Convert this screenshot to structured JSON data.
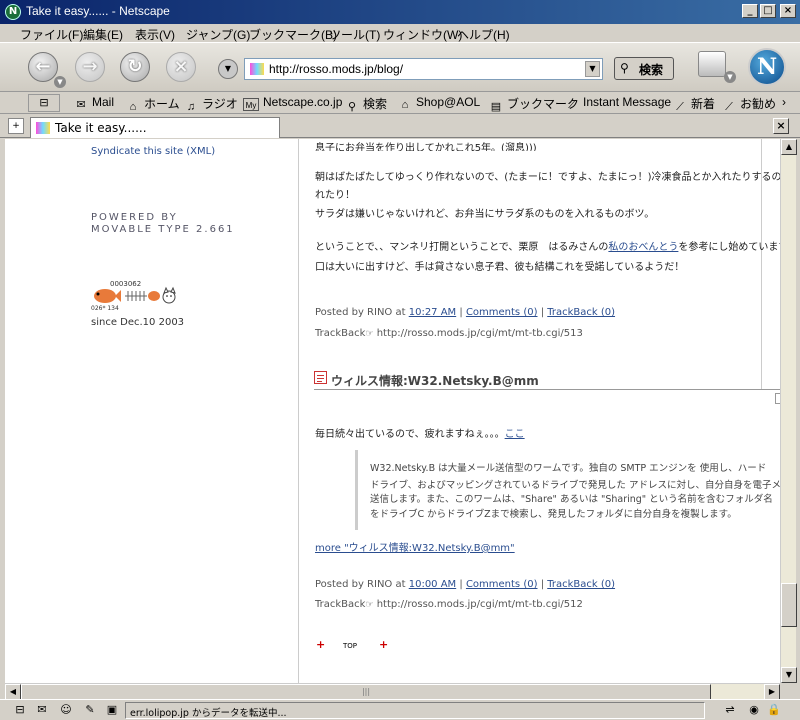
{
  "window": {
    "title": "Take it easy...... - Netscape"
  },
  "menu": [
    "ファイル(F)",
    "編集(E)",
    "表示(V)",
    "ジャンプ(G)",
    "ブックマーク(B)",
    "ツール(T)",
    "ウィンドウ(W)",
    "ヘルプ(H)"
  ],
  "nav": {
    "url": "http://rosso.mods.jp/blog/",
    "search_label": "検索"
  },
  "personal_bar": [
    "Mail",
    "ホーム",
    "ラジオ",
    "Netscape.co.jp",
    "検索",
    "Shop@AOL",
    "ブックマーク",
    "Instant Message",
    "新着",
    "お勧め"
  ],
  "tab": {
    "label": "Take it easy......"
  },
  "sidebar": {
    "syndicate": "Syndicate this site (XML)",
    "powered_line1": "POWERED BY",
    "powered_line2": "MOVABLE TYPE 2.661",
    "counter": "0003062",
    "counter_small": "026* 134",
    "since": "since Dec.10 2003"
  },
  "post1": {
    "cut_line": "息子にお弁当を作り出してかれこれ5年。(溜息)))",
    "para1_line1": "朝はばたばたしてゆっくり作れないので、(たまーに！ですよ、たまにっ！)冷凍食品とか入れたりするのですが、",
    "para1_line2": "れたり！",
    "para1_line3": "サラダは嫌いじゃないけれど、お弁当にサラダ系のものを入れるものボツ。",
    "para2_prefix": "ということで、、マンネリ打開ということで、栗原　はるみさんの",
    "para2_link": "私のおべんとう",
    "para2_suffix": "を参考にし始めています。",
    "para2_line2": "口は大いに出すけど、手は貸さない息子君、彼も結構これを受諾しているようだ！",
    "posted_by": "Posted by RINO at",
    "time": "10:27 AM",
    "comments": "Comments (0)",
    "trackback": "TrackBack (0)",
    "trackback_label": "TrackBack",
    "trackback_url": "http://rosso.mods.jp/cgi/mt/mt-tb.cgi/513"
  },
  "post2": {
    "title": "ウィルス情報:W32.Netsky.B@mm",
    "intro": "毎日続々出ているので、疲れますねぇ。。。",
    "intro_link": "ここ",
    "quote_line1": "W32.Netsky.B は大量メール送信型のワームです。独自の SMTP エンジンを 使用し、ハード",
    "quote_line2": "ドライブ、およびマッピングされているドライブで発見した アドレスに対し、自分自身を電子メールで",
    "quote_line3": "送信します。また、このワームは、\"Share\" あるいは \"Sharing\" という名前を含むフォルダ名",
    "quote_line4": "をドライブC からドライブZまで検索し、発見したフォルダに自分自身を複製します。",
    "more": "more \"ウィルス情報:W32.Netsky.B@mm\"",
    "posted_by": "Posted by RINO at",
    "time": "10:00 AM",
    "comments": "Comments (0)",
    "trackback": "TrackBack (0)",
    "trackback_label": "TrackBack",
    "trackback_url": "http://rosso.mods.jp/cgi/mt/mt-tb.cgi/512"
  },
  "top_link": "TOP",
  "status": {
    "text": "err.lolipop.jp からデータを転送中..."
  },
  "colors": {
    "title_bar": "#0a246a",
    "link": "#2a4d8f",
    "accent_red": "#cc0000"
  }
}
